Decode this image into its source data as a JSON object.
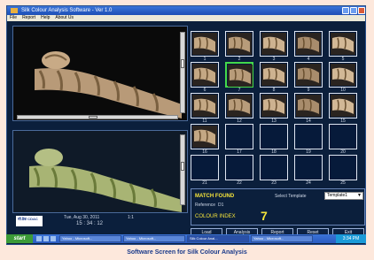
{
  "window": {
    "title": "Silk Colour Analysis Software - Ver 1.0",
    "menu": [
      "File",
      "Report",
      "Help",
      "About Us"
    ]
  },
  "images": {
    "top_icon": "rope-sample-image",
    "bottom_icon": "rope-analysis-image"
  },
  "grid": {
    "selected_index": 6,
    "numbers": [
      "1",
      "2",
      "3",
      "4",
      "5",
      "6",
      "7",
      "8",
      "9",
      "10",
      "11",
      "12",
      "13",
      "14",
      "15",
      "16",
      "17",
      "18",
      "19",
      "20",
      "21",
      "22",
      "23",
      "24",
      "25"
    ],
    "filled_count": 16
  },
  "match": {
    "title": "MATCH FOUND",
    "ref_label": "Reference",
    "ref_value": "D1",
    "colour_index_label": "COLOUR INDEX",
    "colour_index_value": "7",
    "template_label": "Select Template",
    "template_value": "Template1"
  },
  "buttons": [
    "Load",
    "Analysis",
    "Report",
    "Reset",
    "Exit"
  ],
  "footer": {
    "logo_text": "सी.डैक CDAC",
    "date": "Tue, Aug 30, 2011",
    "time": "15 : 34 : 12",
    "scale": "1:1"
  },
  "taskbar": {
    "start_label": "start",
    "tasks": [
      "Yahoo - Microsoft...",
      "Yahoo - Microsoft...",
      "Silk Colour Anal...",
      "Yahoo - Microsoft..."
    ],
    "clock": "3:34 PM"
  },
  "caption": "Software Screen for Silk Colour Analysis",
  "colors": {
    "accent": "#1d4fb6",
    "highlight": "#f5e43a",
    "selection": "#44d84a"
  }
}
